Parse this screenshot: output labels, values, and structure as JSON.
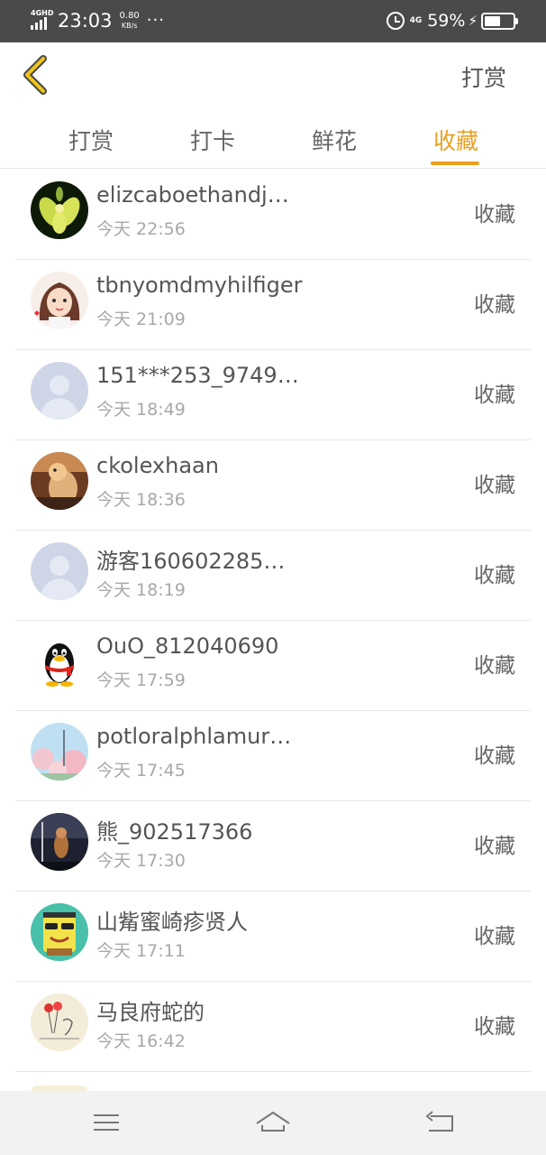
{
  "status_bar": {
    "network": "4GHD",
    "time": "23:03",
    "speed_value": "0.80",
    "speed_unit": "KB/s",
    "more": "···",
    "network_right": "4G",
    "battery_pct": "59%"
  },
  "header": {
    "back_icon": "chevron-left-icon",
    "action_label": "打赏"
  },
  "tabs": [
    {
      "label": "打赏",
      "active": false
    },
    {
      "label": "打卡",
      "active": false
    },
    {
      "label": "鲜花",
      "active": false
    },
    {
      "label": "收藏",
      "active": true
    }
  ],
  "accent_color": "#e9a020",
  "list": [
    {
      "name": "elizcaboethandj…",
      "time": "今天 22:56",
      "action": "收藏",
      "avatar": "flower-avatar"
    },
    {
      "name": "tbnyomdmyhilfiger",
      "time": "今天 21:09",
      "action": "收藏",
      "avatar": "cartoon-girl-avatar"
    },
    {
      "name": "151***253_9749…",
      "time": "今天 18:49",
      "action": "收藏",
      "avatar": "default-avatar"
    },
    {
      "name": "ckolexhaan",
      "time": "今天 18:36",
      "action": "收藏",
      "avatar": "alpaca-avatar"
    },
    {
      "name": "游客160602285…",
      "time": "今天 18:19",
      "action": "收藏",
      "avatar": "default-avatar"
    },
    {
      "name": "OuO_812040690",
      "time": "今天 17:59",
      "action": "收藏",
      "avatar": "qq-penguin-avatar"
    },
    {
      "name": "potloralphlamur…",
      "time": "今天 17:45",
      "action": "收藏",
      "avatar": "blossom-avatar"
    },
    {
      "name": "熊_902517366",
      "time": "今天 17:30",
      "action": "收藏",
      "avatar": "night-scene-avatar"
    },
    {
      "name": "山觜蜜崎疹贤人",
      "time": "今天 17:11",
      "action": "收藏",
      "avatar": "sponge-avatar"
    },
    {
      "name": "马良府蛇的",
      "time": "今天 16:42",
      "action": "收藏",
      "avatar": "sketch-avatar"
    }
  ],
  "nav_bar": {
    "menu_icon": "menu-icon",
    "home_icon": "home-icon",
    "back_icon": "return-icon"
  }
}
